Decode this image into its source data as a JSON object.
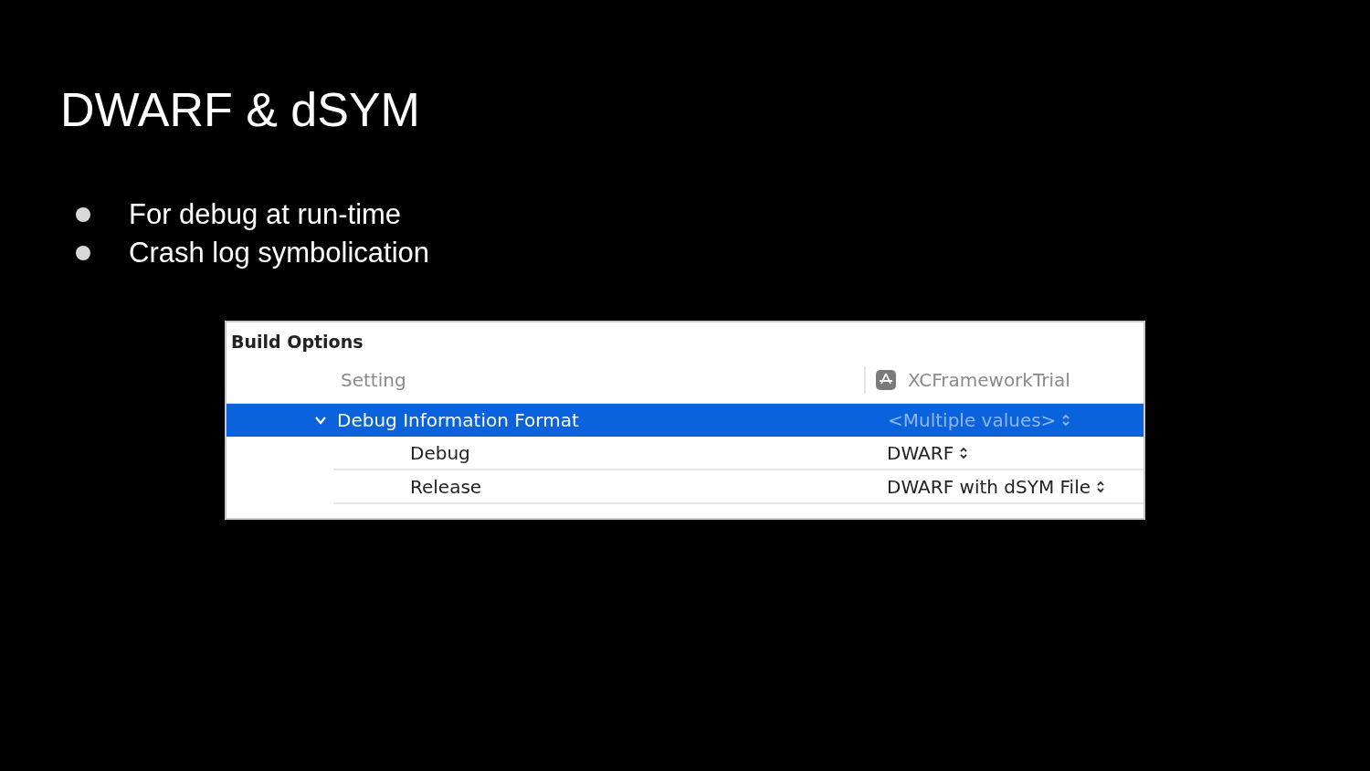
{
  "slide": {
    "title": "DWARF & dSYM",
    "bullets": [
      "For debug at run-time",
      "Crash log symbolication"
    ]
  },
  "build_settings": {
    "section_title": "Build Options",
    "columns": [
      "Setting",
      "XCFrameworkTrial"
    ],
    "rows": [
      {
        "label": "Debug Information Format",
        "value": "<Multiple values>",
        "expanded": true,
        "selected": true,
        "children": [
          {
            "label": "Debug",
            "value": "DWARF",
            "selected": false
          },
          {
            "label": "Release",
            "value": "DWARF with dSYM File",
            "selected": false
          }
        ]
      }
    ]
  }
}
